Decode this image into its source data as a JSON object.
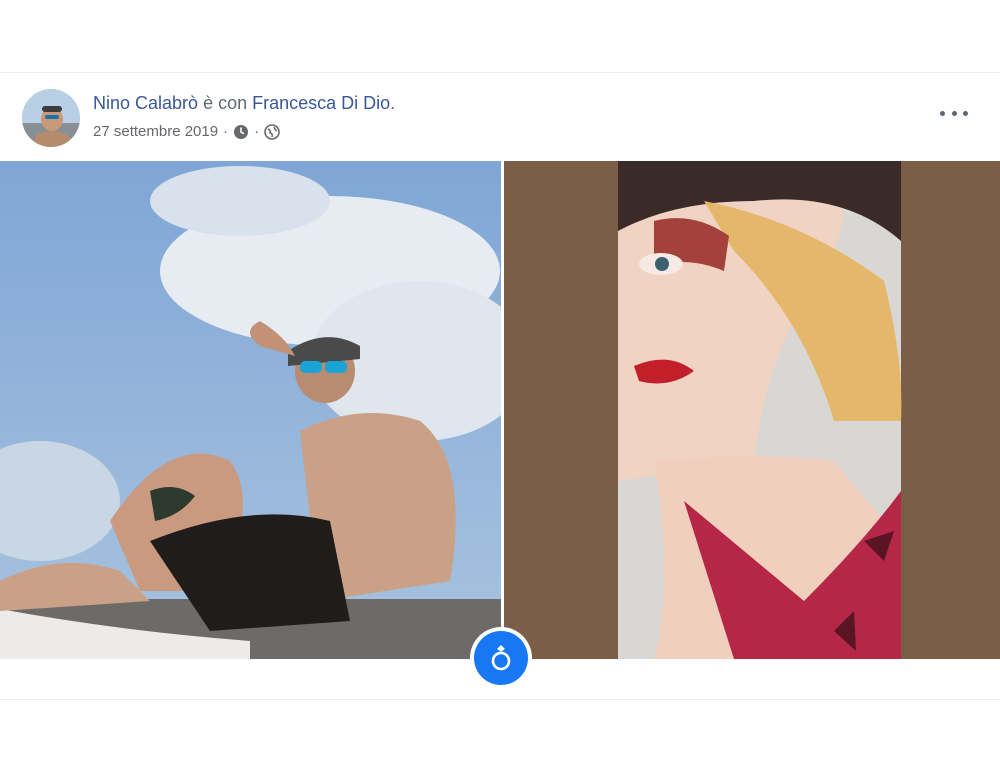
{
  "post": {
    "author": "Nino Calabrò",
    "connector": " è con ",
    "tagged": "Francesca Di Dio",
    "tagged_suffix": ".",
    "date": "27 settembre 2019",
    "separator": "·",
    "privacy_icon": "globe-icon",
    "time_icon": "clock-icon",
    "more_icon": "more-options-icon",
    "badge_icon": "ring-icon"
  },
  "colors": {
    "name_link": "#385898",
    "badge": "#1877f2"
  }
}
